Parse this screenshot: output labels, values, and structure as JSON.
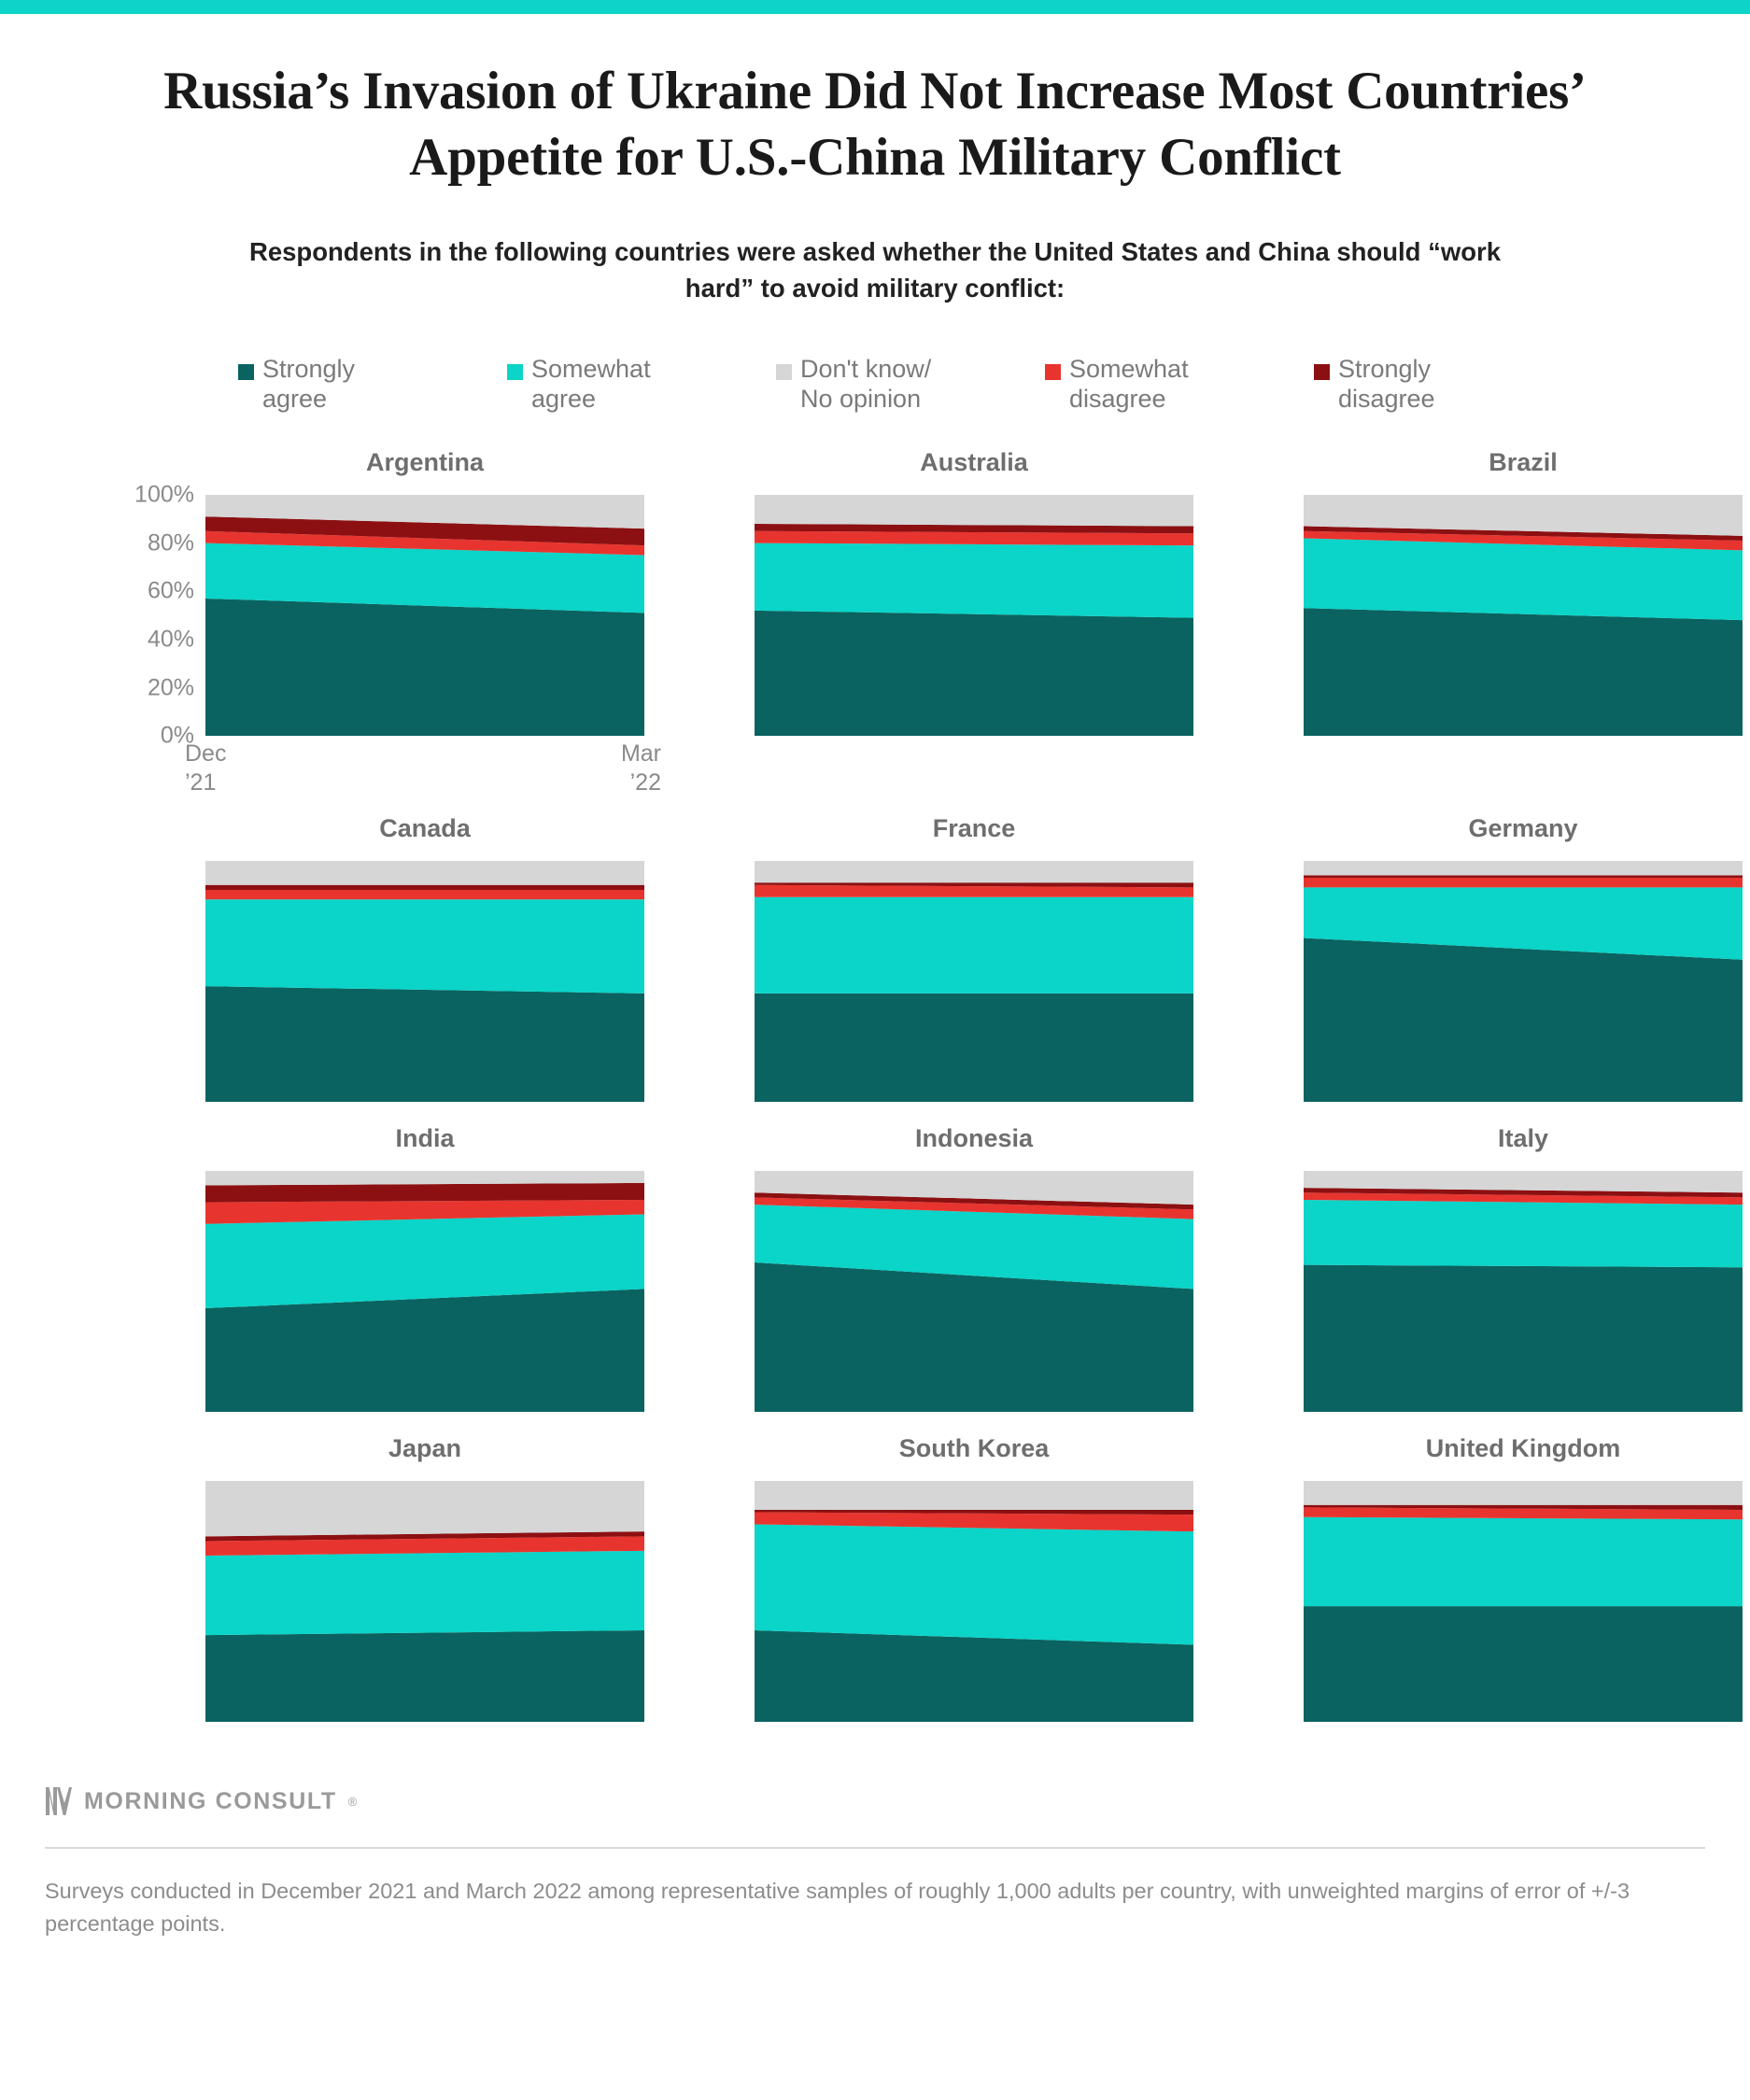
{
  "accent_color": "#0DD3C8",
  "title": "Russia’s Invasion of Ukraine Did Not Increase Most Countries’ Appetite for U.S.-China Military Conflict",
  "subtitle": "Respondents in the following countries were asked whether the United States and China should “work hard” to avoid military conflict:",
  "legend": [
    {
      "label": "Strongly\nagree",
      "color": "#0A6360",
      "key": "strongly_agree"
    },
    {
      "label": "Somewhat\nagree",
      "color": "#0BD4C8",
      "key": "somewhat_agree"
    },
    {
      "label": "Don't know/\nNo opinion",
      "color": "#D6D6D6",
      "key": "dont_know"
    },
    {
      "label": "Somewhat\ndisagree",
      "color": "#E8342F",
      "key": "somewhat_disagree"
    },
    {
      "label": "Strongly\ndisagree",
      "color": "#8C1012",
      "key": "strongly_disagree"
    }
  ],
  "axis": {
    "y_ticks": [
      "100%",
      "80%",
      "60%",
      "40%",
      "20%",
      "0%"
    ],
    "y_values": [
      100,
      80,
      60,
      40,
      20,
      0
    ],
    "x_left": "Dec\n’21",
    "x_right": "Mar\n’22"
  },
  "footer": {
    "brand": "MORNING CONSULT",
    "brand_reg": "®",
    "note": "Surveys conducted in December 2021 and March 2022 among representative samples of roughly 1,000 adults per country, with unweighted margins of error of +/-3 percentage points."
  },
  "chart_data": {
    "type": "area",
    "title": "Russia’s Invasion of Ukraine Did Not Increase Most Countries’ Appetite for U.S.-China Military Conflict",
    "subtitle": "Respondents in the following countries were asked whether the United States and China should “work hard” to avoid military conflict:",
    "stacked": true,
    "normalized_percent": true,
    "x": [
      "Dec '21",
      "Mar '22"
    ],
    "xlabel": "",
    "ylabel": "",
    "ylim": [
      0,
      100
    ],
    "grid": false,
    "legend_position": "top",
    "series_order": [
      "strongly_agree",
      "somewhat_agree",
      "somewhat_disagree",
      "strongly_disagree",
      "dont_know"
    ],
    "series_labels": {
      "strongly_agree": "Strongly agree",
      "somewhat_agree": "Somewhat agree",
      "dont_know": "Don't know/No opinion",
      "somewhat_disagree": "Somewhat disagree",
      "strongly_disagree": "Strongly disagree"
    },
    "series_colors": {
      "strongly_agree": "#0A6360",
      "somewhat_agree": "#0BD4C8",
      "dont_know": "#D6D6D6",
      "somewhat_disagree": "#E8342F",
      "strongly_disagree": "#8C1012"
    },
    "panels": [
      {
        "country": "Argentina",
        "values": {
          "strongly_agree": [
            57,
            51
          ],
          "somewhat_agree": [
            23,
            24
          ],
          "somewhat_disagree": [
            5,
            4
          ],
          "strongly_disagree": [
            6,
            7
          ],
          "dont_know": [
            9,
            14
          ]
        }
      },
      {
        "country": "Australia",
        "values": {
          "strongly_agree": [
            52,
            49
          ],
          "somewhat_agree": [
            28,
            30
          ],
          "somewhat_disagree": [
            5,
            5
          ],
          "strongly_disagree": [
            3,
            3
          ],
          "dont_know": [
            12,
            13
          ]
        }
      },
      {
        "country": "Brazil",
        "values": {
          "strongly_agree": [
            53,
            48
          ],
          "somewhat_agree": [
            29,
            29
          ],
          "somewhat_disagree": [
            3,
            4
          ],
          "strongly_disagree": [
            2,
            2
          ],
          "dont_know": [
            13,
            17
          ]
        }
      },
      {
        "country": "Canada",
        "values": {
          "strongly_agree": [
            48,
            45
          ],
          "somewhat_agree": [
            36,
            39
          ],
          "somewhat_disagree": [
            4,
            4
          ],
          "strongly_disagree": [
            2,
            2
          ],
          "dont_know": [
            10,
            10
          ]
        }
      },
      {
        "country": "France",
        "values": {
          "strongly_agree": [
            45,
            45
          ],
          "somewhat_agree": [
            40,
            40
          ],
          "somewhat_disagree": [
            5,
            4
          ],
          "strongly_disagree": [
            1,
            2
          ],
          "dont_know": [
            9,
            9
          ]
        }
      },
      {
        "country": "Germany",
        "values": {
          "strongly_agree": [
            68,
            59
          ],
          "somewhat_agree": [
            21,
            30
          ],
          "somewhat_disagree": [
            4,
            4
          ],
          "strongly_disagree": [
            1,
            1
          ],
          "dont_know": [
            6,
            6
          ]
        }
      },
      {
        "country": "India",
        "values": {
          "strongly_agree": [
            43,
            51
          ],
          "somewhat_agree": [
            35,
            31
          ],
          "somewhat_disagree": [
            9,
            6
          ],
          "strongly_disagree": [
            7,
            7
          ],
          "dont_know": [
            6,
            5
          ]
        }
      },
      {
        "country": "Indonesia",
        "values": {
          "strongly_agree": [
            62,
            51
          ],
          "somewhat_agree": [
            24,
            29
          ],
          "somewhat_disagree": [
            3,
            4
          ],
          "strongly_disagree": [
            2,
            2
          ],
          "dont_know": [
            9,
            14
          ]
        }
      },
      {
        "country": "Italy",
        "values": {
          "strongly_agree": [
            61,
            60
          ],
          "somewhat_agree": [
            27,
            26
          ],
          "somewhat_disagree": [
            3,
            3
          ],
          "strongly_disagree": [
            2,
            2
          ],
          "dont_know": [
            7,
            9
          ]
        }
      },
      {
        "country": "Japan",
        "values": {
          "strongly_agree": [
            36,
            38
          ],
          "somewhat_agree": [
            33,
            33
          ],
          "somewhat_disagree": [
            6,
            6
          ],
          "strongly_disagree": [
            2,
            2
          ],
          "dont_know": [
            23,
            21
          ]
        }
      },
      {
        "country": "South Korea",
        "values": {
          "strongly_agree": [
            38,
            32
          ],
          "somewhat_agree": [
            44,
            47
          ],
          "somewhat_disagree": [
            5,
            7
          ],
          "strongly_disagree": [
            1,
            2
          ],
          "dont_know": [
            12,
            12
          ]
        }
      },
      {
        "country": "United Kingdom",
        "values": {
          "strongly_agree": [
            48,
            48
          ],
          "somewhat_agree": [
            37,
            36
          ],
          "somewhat_disagree": [
            4,
            4
          ],
          "strongly_disagree": [
            1,
            2
          ],
          "dont_know": [
            10,
            10
          ]
        }
      }
    ]
  }
}
